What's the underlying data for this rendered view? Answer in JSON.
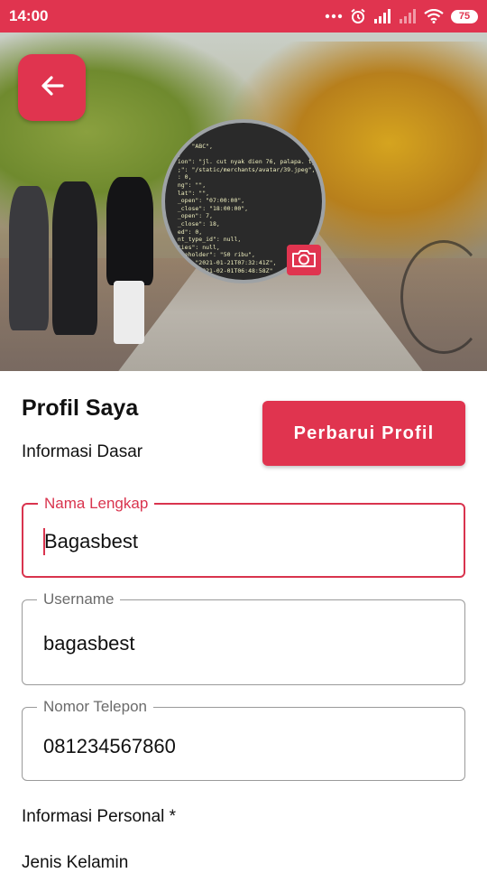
{
  "status_bar": {
    "time": "14:00",
    "battery": "75",
    "background_color": "#e0344f"
  },
  "header": {
    "back_icon": "arrow-left-icon",
    "camera_icon": "camera-icon",
    "avatar_code_lines": [
      "      \"ABC\",",
      "  ,",
      "  ion\": \"jl. cut nyak dien 76, palapa. tj. kerang",
      "  ;\": \"/static/merchants/avatar/39.jpeg\",",
      "  : 0,",
      "  ng\": \"\",",
      "  lat\": \"\",",
      "  _open\": \"07:00:00\",",
      "  _close\": \"18:00:00\",",
      "  _open\": 7,",
      "  _close\": 18,",
      "  ed\": 0,",
      "  nt_type_id\": null,",
      "  ties\": null,",
      "  aceholder\": \"50 ribu\",",
      "       \"2021-01-21T07:32:41Z\",",
      "       \"2021-02-01T06:48:58Z\""
    ]
  },
  "profile": {
    "title": "Profil Saya",
    "basic_info_label": "Informasi Dasar",
    "update_button_label": "Perbarui Profil",
    "accent_color": "#e0344f"
  },
  "fields": {
    "full_name": {
      "label": "Nama Lengkap",
      "value": "Bagasbest"
    },
    "username": {
      "label": "Username",
      "value": "bagasbest"
    },
    "phone": {
      "label": "Nomor Telepon",
      "value": "081234567860"
    }
  },
  "personal": {
    "label": "Informasi Personal *",
    "gender_label": "Jenis Kelamin"
  }
}
